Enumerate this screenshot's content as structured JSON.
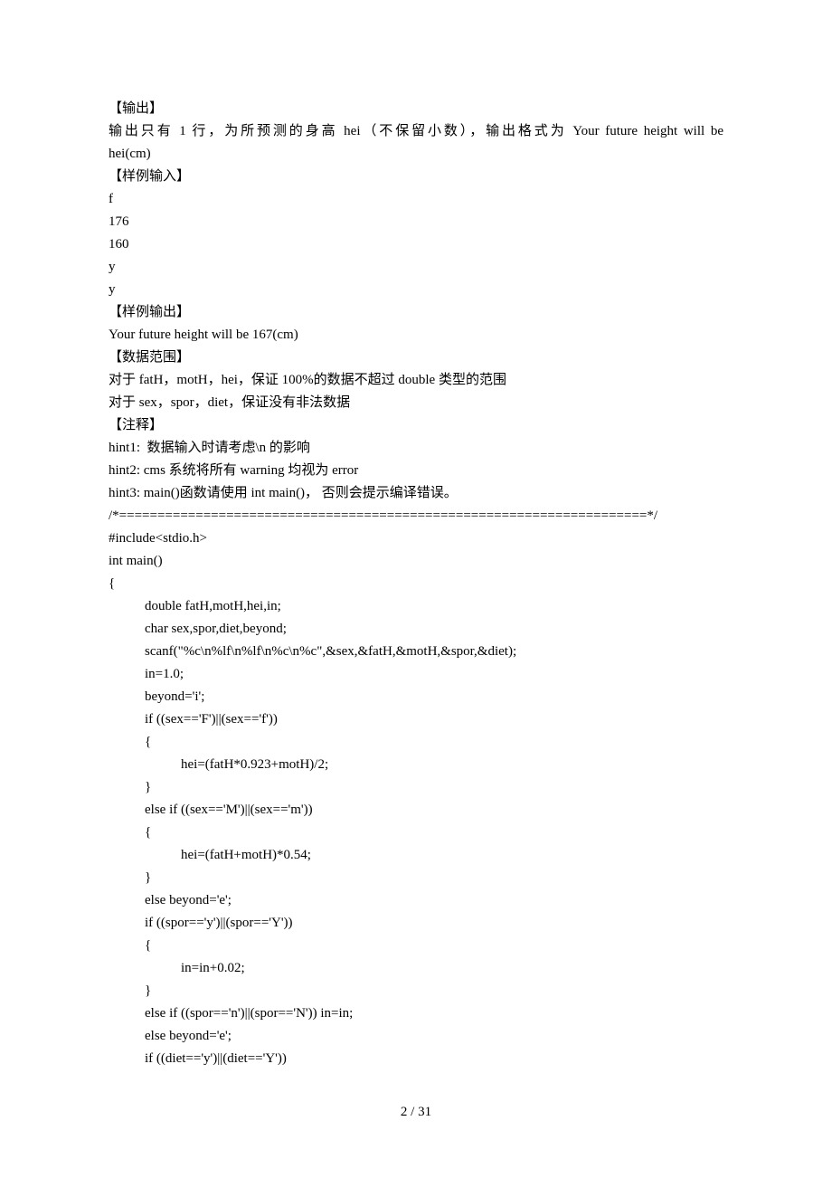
{
  "lines": [
    {
      "cls": "line",
      "text": "【输出】"
    },
    {
      "cls": "line justify",
      "text": "输出只有 1 行，为所预测的身高 hei（不保留小数），输出格式为 Your future height will be"
    },
    {
      "cls": "line",
      "text": "hei(cm)"
    },
    {
      "cls": "line",
      "text": "【样例输入】"
    },
    {
      "cls": "line",
      "text": "f"
    },
    {
      "cls": "line",
      "text": "176"
    },
    {
      "cls": "line",
      "text": "160"
    },
    {
      "cls": "line",
      "text": "y"
    },
    {
      "cls": "line",
      "text": "y"
    },
    {
      "cls": "line",
      "text": "【样例输出】"
    },
    {
      "cls": "line",
      "text": "Your future height will be 167(cm)"
    },
    {
      "cls": "line",
      "text": "【数据范围】"
    },
    {
      "cls": "line",
      "text": "对于 fatH，motH，hei，保证 100%的数据不超过 double 类型的范围"
    },
    {
      "cls": "line",
      "text": "对于 sex，spor，diet，保证没有非法数据"
    },
    {
      "cls": "line",
      "text": "【注释】"
    },
    {
      "cls": "line",
      "text": "hint1:  数据输入时请考虑\\n 的影响"
    },
    {
      "cls": "line",
      "text": "hint2: cms 系统将所有 warning 均视为 error"
    },
    {
      "cls": "line",
      "text": "hint3: main()函数请使用 int main()， 否则会提示编译错误。"
    },
    {
      "cls": "line",
      "text": "/*=====================================================================*/"
    },
    {
      "cls": "line",
      "text": "#include<stdio.h>"
    },
    {
      "cls": "line",
      "text": "int main()"
    },
    {
      "cls": "line",
      "text": "{"
    },
    {
      "cls": "line indent1",
      "text": "double fatH,motH,hei,in;"
    },
    {
      "cls": "line indent1",
      "text": "char sex,spor,diet,beyond;"
    },
    {
      "cls": "line indent1",
      "text": ""
    },
    {
      "cls": "line indent1",
      "text": "scanf(\"%c\\n%lf\\n%lf\\n%c\\n%c\",&sex,&fatH,&motH,&spor,&diet);"
    },
    {
      "cls": "line indent1",
      "text": "in=1.0;"
    },
    {
      "cls": "line indent1",
      "text": "beyond='i';"
    },
    {
      "cls": "line indent1",
      "text": "if ((sex=='F')||(sex=='f'))"
    },
    {
      "cls": "line indent1",
      "text": "{"
    },
    {
      "cls": "line indent2",
      "text": "hei=(fatH*0.923+motH)/2;"
    },
    {
      "cls": "line indent1",
      "text": "}"
    },
    {
      "cls": "line indent1",
      "text": "else if ((sex=='M')||(sex=='m'))"
    },
    {
      "cls": "line indent1",
      "text": "{"
    },
    {
      "cls": "line indent2",
      "text": "hei=(fatH+motH)*0.54;"
    },
    {
      "cls": "line indent1",
      "text": "}"
    },
    {
      "cls": "line indent1",
      "text": "else beyond='e';"
    },
    {
      "cls": "line indent1",
      "text": "if ((spor=='y')||(spor=='Y'))"
    },
    {
      "cls": "line indent1",
      "text": "{"
    },
    {
      "cls": "line indent2",
      "text": "in=in+0.02;"
    },
    {
      "cls": "line indent1",
      "text": "}"
    },
    {
      "cls": "line indent1",
      "text": "else if ((spor=='n')||(spor=='N')) in=in;"
    },
    {
      "cls": "line indent1",
      "text": "else beyond='e';"
    },
    {
      "cls": "line indent1",
      "text": "if ((diet=='y')||(diet=='Y'))"
    }
  ],
  "footer": "2  / 31"
}
